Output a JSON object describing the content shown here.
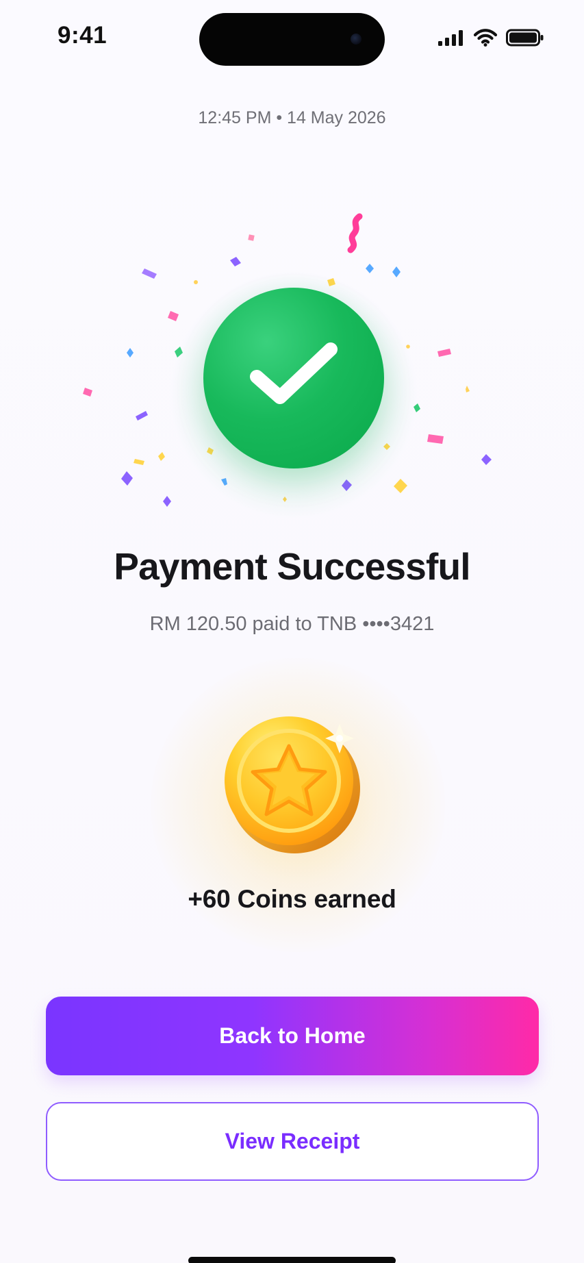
{
  "status_bar": {
    "time": "9:41",
    "icons": [
      "signal-icon",
      "wifi-icon",
      "battery-icon"
    ]
  },
  "receipt": {
    "timestamp": "12:45 PM • 14 May 2026",
    "title": "Payment Successful",
    "details": "RM 120.50 paid to TNB ••••3421",
    "icon": "checkmark-icon"
  },
  "rewards": {
    "coin_text": "+60 Coins earned",
    "icon": "coin-star-icon"
  },
  "actions": {
    "primary": "Back to Home",
    "secondary": "View Receipt"
  },
  "colors": {
    "success": "#18B95B",
    "primary_start": "#7A35FF",
    "primary_end": "#FF2AA7",
    "coin": "#FFC02E",
    "text": "#17171B"
  }
}
